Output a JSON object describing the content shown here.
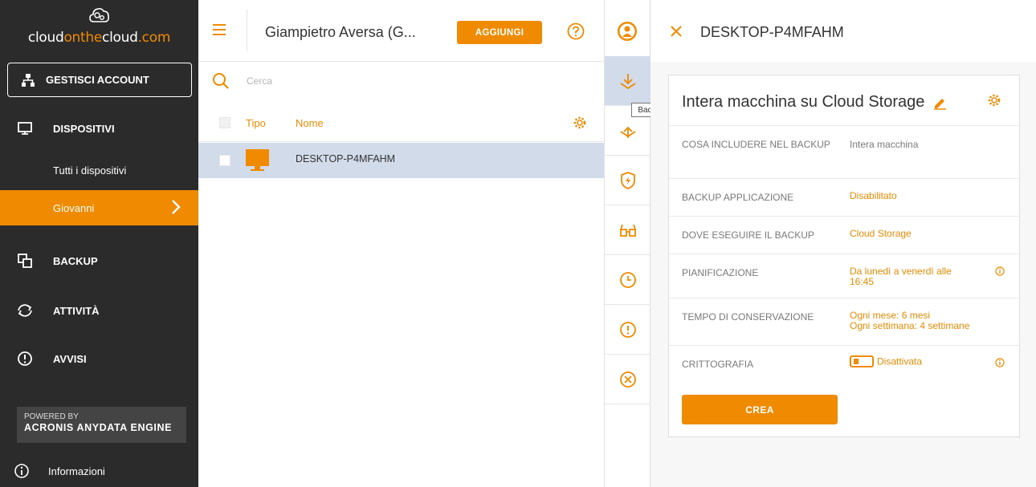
{
  "brand": {
    "logo_white1": "cloud",
    "logo_orange": "onthe",
    "logo_white2": "cloud",
    "logo_orange2": ".com",
    "accent": "#f08a00",
    "sidebar_bg": "#2b2b2b"
  },
  "sidebar": {
    "manage_account": "GESTISCI ACCOUNT",
    "devices": "DISPOSITIVI",
    "all_devices": "Tutti i dispositivi",
    "group_selected": "Giovanni",
    "backup": "BACKUP",
    "activities": "ATTIVITÀ",
    "alerts": "AVVISI",
    "powered_by": "POWERED BY",
    "engine": "ACRONIS ANYDATA ENGINE",
    "info": "Informazioni"
  },
  "topbar": {
    "tenant": "Giampietro Aversa (G...",
    "add_label": "AGGIUNGI"
  },
  "search": {
    "placeholder": "Cerca"
  },
  "table": {
    "col_type": "Tipo",
    "col_name": "Nome",
    "rows": [
      {
        "name": "DESKTOP-P4MFAHM",
        "icon": "desktop-monitor-icon"
      }
    ]
  },
  "actions": {
    "tooltip": "Backup",
    "icons": [
      "backup-icon",
      "recovery-icon",
      "protection-icon",
      "glasses-icon",
      "clock-icon",
      "alert-icon",
      "cancel-icon"
    ]
  },
  "detail": {
    "title": "DESKTOP-P4MFAHM",
    "plan_title": "Intera macchina su Cloud Storage",
    "rows": [
      {
        "label": "COSA INCLUDERE NEL BACKUP",
        "value": "Intera macchina"
      },
      {
        "label": "BACKUP APPLICAZIONE",
        "value": "Disabilitato"
      },
      {
        "label": "DOVE ESEGUIRE IL BACKUP",
        "value": "Cloud Storage"
      },
      {
        "label": "PIANIFICAZIONE",
        "value": "Da lunedì a venerdì alle 16:45"
      },
      {
        "label": "TEMPO DI CONSERVAZIONE",
        "value_line1": "Ogni mese: 6 mesi",
        "value_line2": "Ogni settimana: 4 settimane"
      },
      {
        "label": "CRITTOGRAFIA",
        "value": "Disattivata"
      }
    ],
    "create_label": "CREA"
  }
}
